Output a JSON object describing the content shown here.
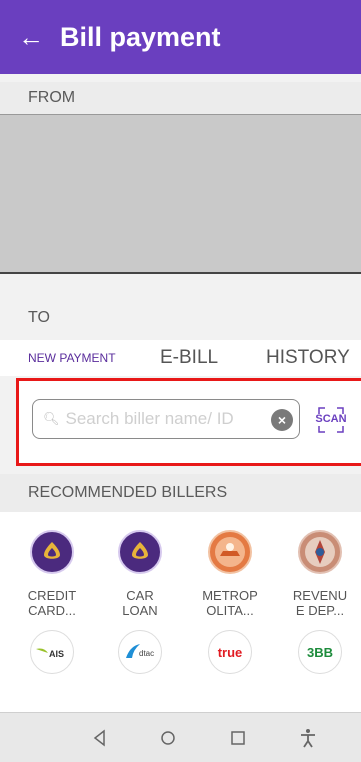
{
  "header": {
    "back_icon": "arrow-left-icon",
    "title": "Bill payment"
  },
  "from": {
    "label": "FROM"
  },
  "to": {
    "label": "TO"
  },
  "tabs": [
    {
      "label": "NEW PAYMENT",
      "active": true
    },
    {
      "label": "E-BILL",
      "active": false
    },
    {
      "label": "HISTORY",
      "active": false
    }
  ],
  "search": {
    "placeholder": "Search biller name/ ID",
    "value": "",
    "scan_label": "SCAN"
  },
  "recommended": {
    "label": "RECOMMENDED BILLERS",
    "billers": [
      {
        "name": "CREDIT\nCARD..."
      },
      {
        "name": "CAR\nLOAN"
      },
      {
        "name": "METROP\nOLITA..."
      },
      {
        "name": "REVENU\nE DEP..."
      }
    ],
    "logos_row2": [
      {
        "text": "AIS"
      },
      {
        "text": "dtac"
      },
      {
        "text": "true"
      },
      {
        "text": "3BB"
      }
    ]
  },
  "colors": {
    "brand_purple": "#6a3fbf",
    "highlight_red": "#e81818"
  }
}
